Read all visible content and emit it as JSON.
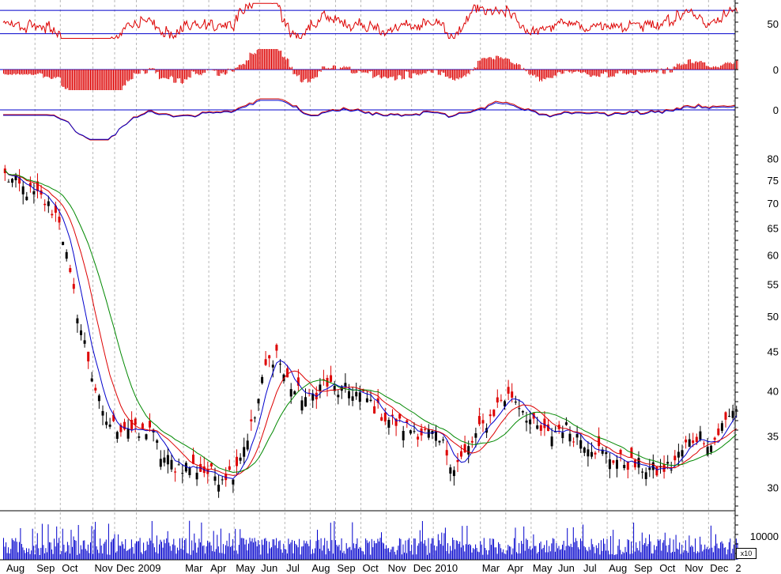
{
  "chart_data": [
    {
      "type": "line",
      "panel": "oscillator-1",
      "series_color": "#dd0000",
      "guide_color": "#0000cc",
      "reference_lines": [
        30,
        70
      ],
      "y_tick_labels": [
        "50"
      ],
      "approx_range": [
        20,
        85
      ]
    },
    {
      "type": "bar",
      "panel": "histogram",
      "bar_color": "#dd0000",
      "y_tick_labels": [
        "0"
      ]
    },
    {
      "type": "line",
      "panel": "oscillator-2",
      "series": [
        {
          "color": "#cc0000"
        },
        {
          "color": "#0000cc"
        }
      ],
      "y_tick_labels": [
        "0"
      ]
    },
    {
      "type": "candlestick",
      "panel": "price",
      "scale": "log",
      "ylim": [
        28,
        82
      ],
      "y_tick_labels": [
        "80",
        "75",
        "70",
        "65",
        "60",
        "55",
        "50",
        "45",
        "40",
        "35",
        "30"
      ],
      "moving_averages": [
        {
          "color": "#0000cc"
        },
        {
          "color": "#dd0000"
        },
        {
          "color": "#008800"
        }
      ],
      "path_points": [
        [
          0,
          76
        ],
        [
          5,
          73
        ],
        [
          10,
          71
        ],
        [
          15,
          67
        ],
        [
          18,
          56
        ],
        [
          21,
          48
        ],
        [
          24,
          42
        ],
        [
          27,
          37
        ],
        [
          30,
          36
        ],
        [
          34,
          36
        ],
        [
          37,
          35
        ],
        [
          40,
          36
        ],
        [
          43,
          33
        ],
        [
          47,
          32
        ],
        [
          51,
          32
        ],
        [
          55,
          31.5
        ],
        [
          59,
          31
        ],
        [
          63,
          31.5
        ],
        [
          66,
          34
        ],
        [
          69,
          37
        ],
        [
          72,
          43
        ],
        [
          75,
          45
        ],
        [
          77,
          42
        ],
        [
          80,
          40
        ],
        [
          84,
          39
        ],
        [
          88,
          41
        ],
        [
          92,
          40
        ],
        [
          96,
          40
        ],
        [
          100,
          39
        ],
        [
          105,
          37
        ],
        [
          110,
          36
        ],
        [
          114,
          35.5
        ],
        [
          118,
          35
        ],
        [
          121,
          34
        ],
        [
          124,
          32
        ],
        [
          127,
          33
        ],
        [
          130,
          35
        ],
        [
          134,
          37
        ],
        [
          137,
          39
        ],
        [
          140,
          39.5
        ],
        [
          143,
          38
        ],
        [
          146,
          36
        ],
        [
          150,
          35
        ],
        [
          154,
          36
        ],
        [
          158,
          35
        ],
        [
          162,
          34
        ],
        [
          166,
          33
        ],
        [
          170,
          32.5
        ],
        [
          175,
          32
        ],
        [
          180,
          31.5
        ],
        [
          184,
          32
        ],
        [
          188,
          34
        ],
        [
          191,
          35
        ],
        [
          193,
          35
        ],
        [
          195,
          34
        ],
        [
          198,
          36
        ],
        [
          200,
          37
        ],
        [
          201,
          38
        ]
      ]
    },
    {
      "type": "bar",
      "panel": "volume",
      "bar_color": "#0000cc",
      "y_tick_labels": [
        "10000"
      ],
      "multiplier_label": "x10"
    }
  ],
  "x_axis": {
    "labels": [
      {
        "text": "Aug",
        "pos": 0
      },
      {
        "text": "Sep",
        "pos": 9
      },
      {
        "text": "Oct",
        "pos": 16
      },
      {
        "text": "Nov",
        "pos": 25
      },
      {
        "text": "Dec",
        "pos": 31
      },
      {
        "text": "2009",
        "pos": 37
      },
      {
        "text": "Mar",
        "pos": 50
      },
      {
        "text": "Apr",
        "pos": 57
      },
      {
        "text": "May",
        "pos": 64
      },
      {
        "text": "Jun",
        "pos": 71
      },
      {
        "text": "Jul",
        "pos": 78
      },
      {
        "text": "Aug",
        "pos": 85
      },
      {
        "text": "Sep",
        "pos": 92
      },
      {
        "text": "Oct",
        "pos": 99
      },
      {
        "text": "Nov",
        "pos": 106
      },
      {
        "text": "Dec",
        "pos": 113
      },
      {
        "text": "2010",
        "pos": 119
      },
      {
        "text": "Mar",
        "pos": 132
      },
      {
        "text": "Apr",
        "pos": 139
      },
      {
        "text": "May",
        "pos": 146
      },
      {
        "text": "Jun",
        "pos": 153
      },
      {
        "text": "Jul",
        "pos": 160
      },
      {
        "text": "Aug",
        "pos": 167
      },
      {
        "text": "Sep",
        "pos": 174
      },
      {
        "text": "Oct",
        "pos": 181
      },
      {
        "text": "Nov",
        "pos": 188
      },
      {
        "text": "Dec",
        "pos": 195
      },
      {
        "text": "2",
        "pos": 202
      }
    ]
  },
  "style": {
    "grid_color": "#b8b8b8",
    "axis_color": "#000000"
  }
}
